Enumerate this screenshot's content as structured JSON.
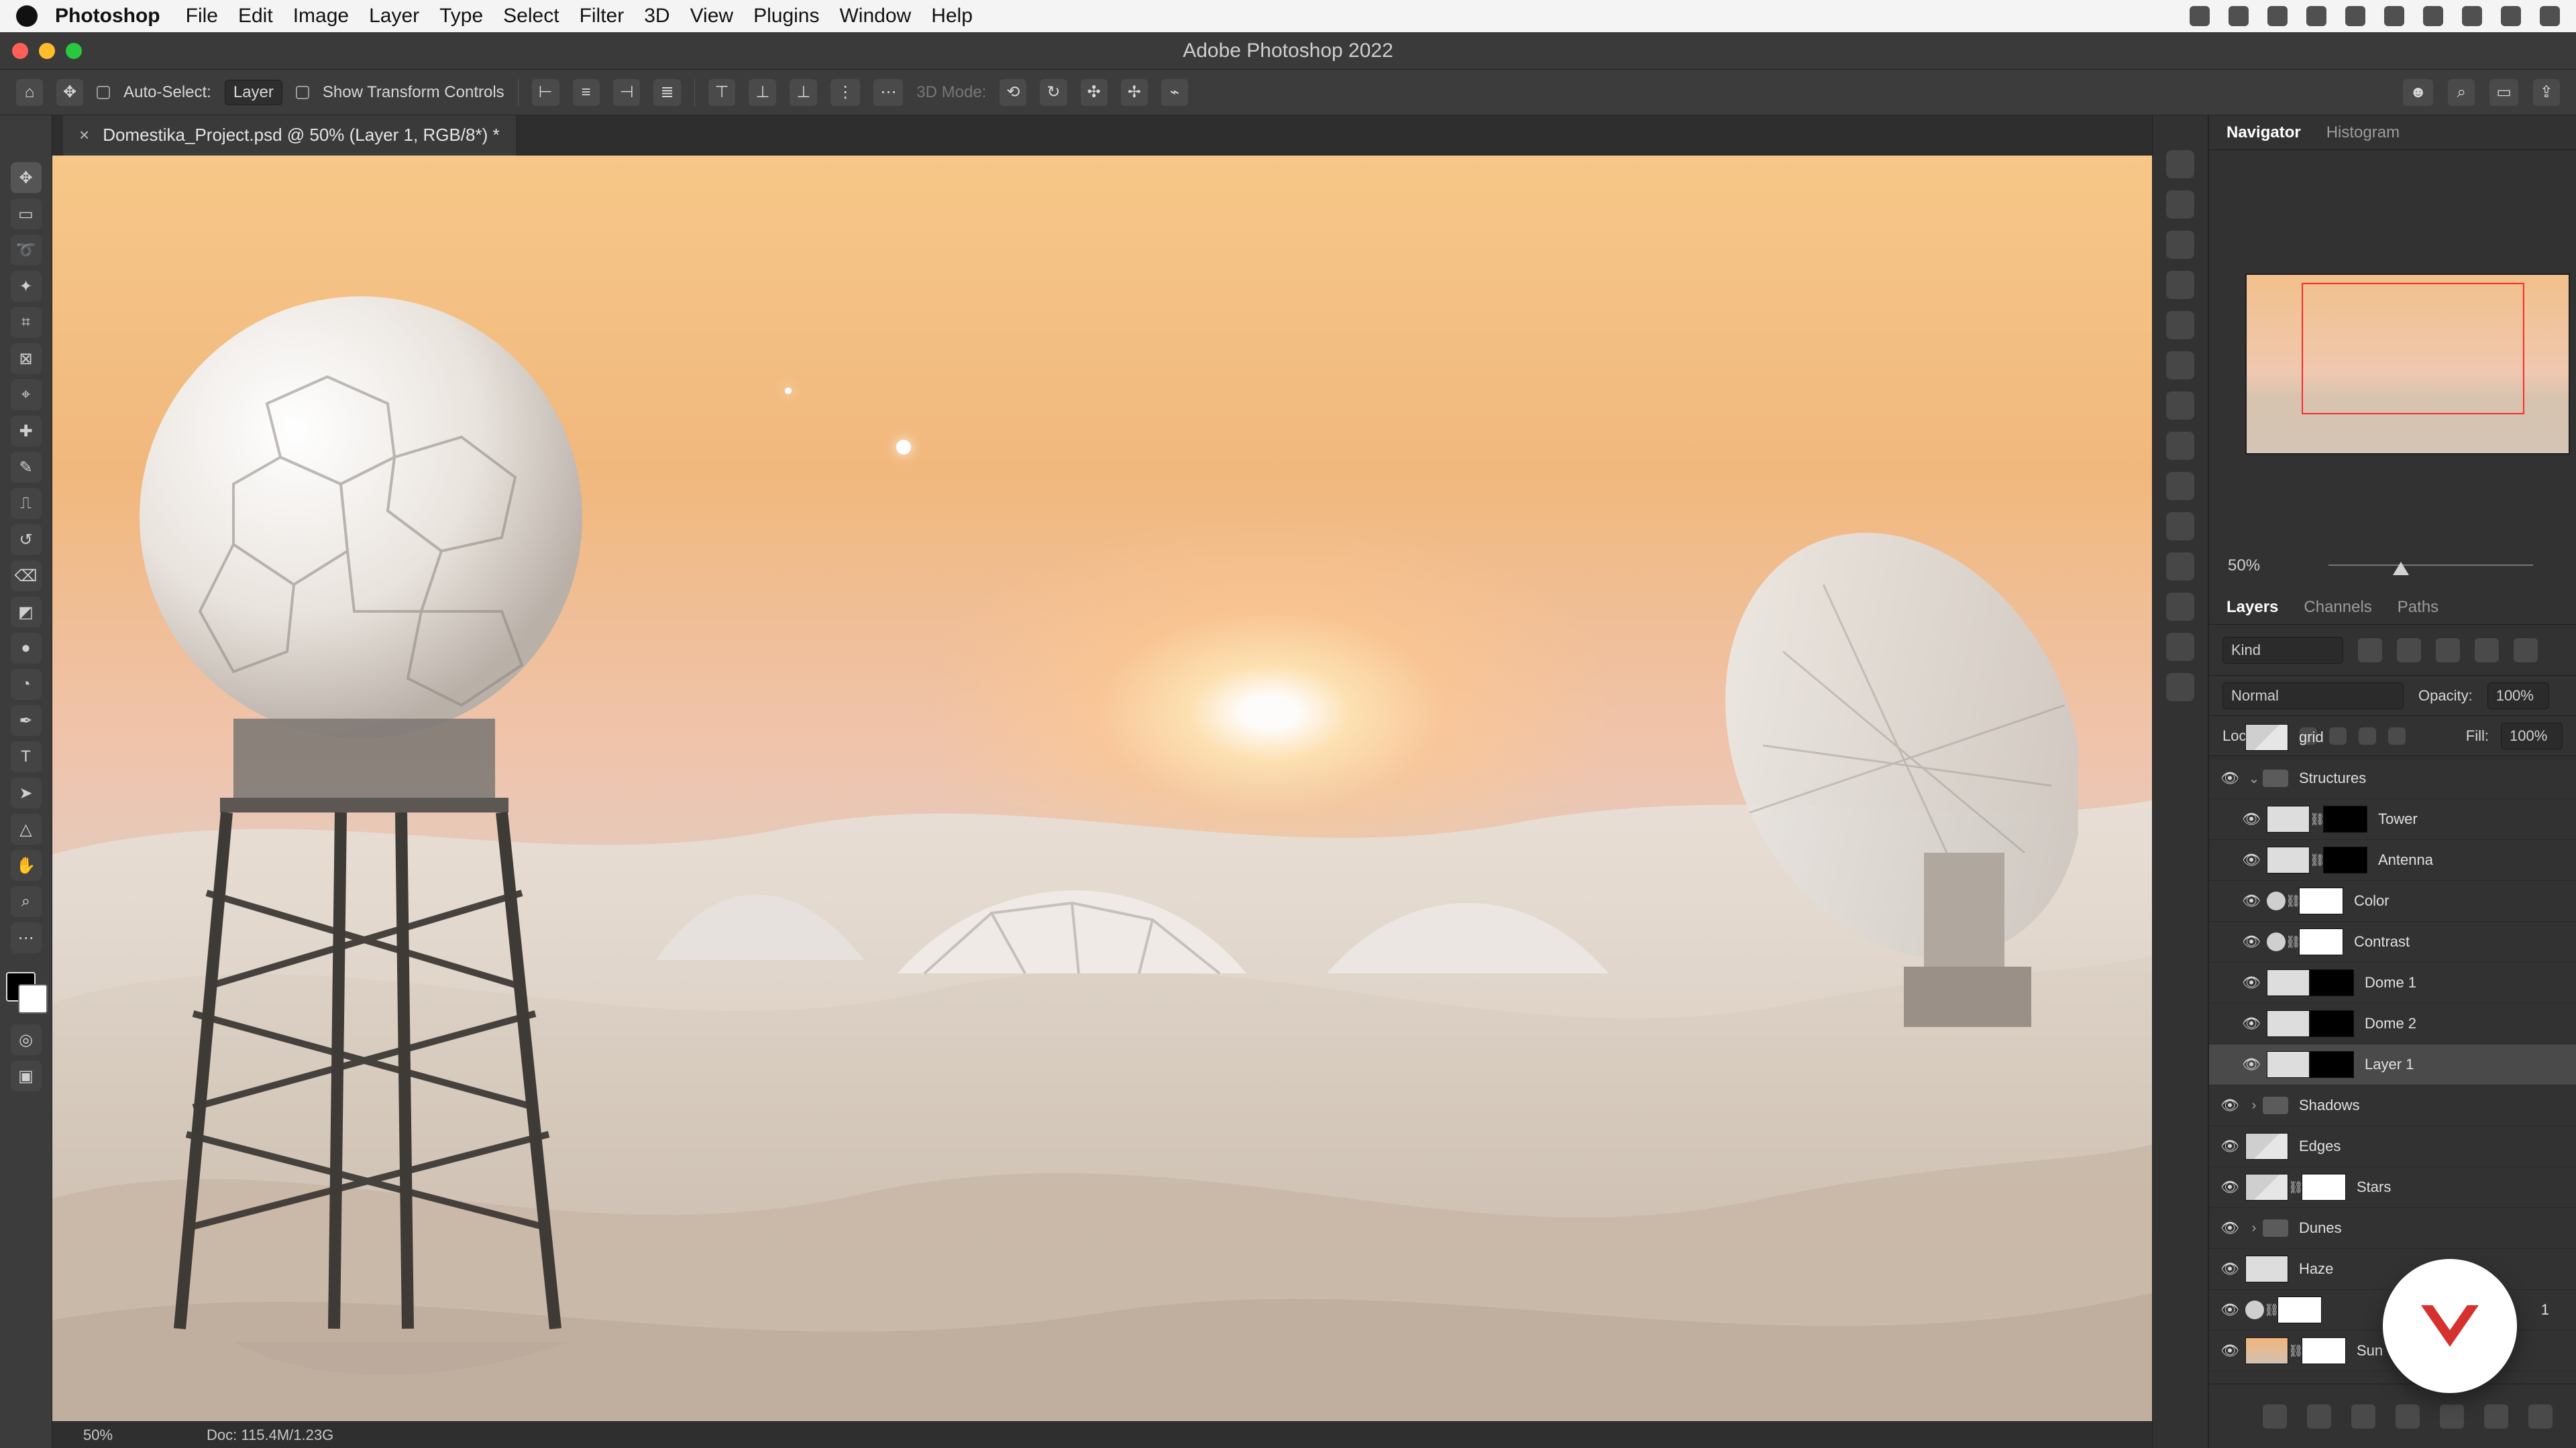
{
  "menubar": {
    "app": "Photoshop",
    "items": [
      "File",
      "Edit",
      "Image",
      "Layer",
      "Type",
      "Select",
      "Filter",
      "3D",
      "View",
      "Plugins",
      "Window",
      "Help"
    ]
  },
  "window": {
    "title": "Adobe Photoshop 2022"
  },
  "options": {
    "auto_select_label": "Auto-Select:",
    "auto_select_value": "Layer",
    "show_transform_label": "Show Transform Controls",
    "three_d_mode": "3D Mode:"
  },
  "document": {
    "tab_name": "Domestika_Project.psd @ 50% (Layer 1, RGB/8*) *"
  },
  "navigator": {
    "tabs": [
      "Navigator",
      "Histogram"
    ],
    "zoom": "50%"
  },
  "layers": {
    "tabs": [
      "Layers",
      "Channels",
      "Paths"
    ],
    "kind": "Kind",
    "blend": "Normal",
    "opacity_label": "Opacity:",
    "opacity": "100%",
    "lock_label": "Lock:",
    "fill_label": "Fill:",
    "fill": "100%",
    "rows": [
      {
        "name": "grid"
      },
      {
        "name": "Structures"
      },
      {
        "name": "Tower"
      },
      {
        "name": "Antenna"
      },
      {
        "name": "Color"
      },
      {
        "name": "Contrast"
      },
      {
        "name": "Dome 1"
      },
      {
        "name": "Dome 2"
      },
      {
        "name": "Layer 1"
      },
      {
        "name": "Shadows"
      },
      {
        "name": "Edges"
      },
      {
        "name": "Stars"
      },
      {
        "name": "Dunes"
      },
      {
        "name": "Haze"
      },
      {
        "name": "1"
      },
      {
        "name": "Sun"
      }
    ]
  },
  "status": {
    "zoom": "50%",
    "doc": "Doc: 115.4M/1.23G"
  }
}
